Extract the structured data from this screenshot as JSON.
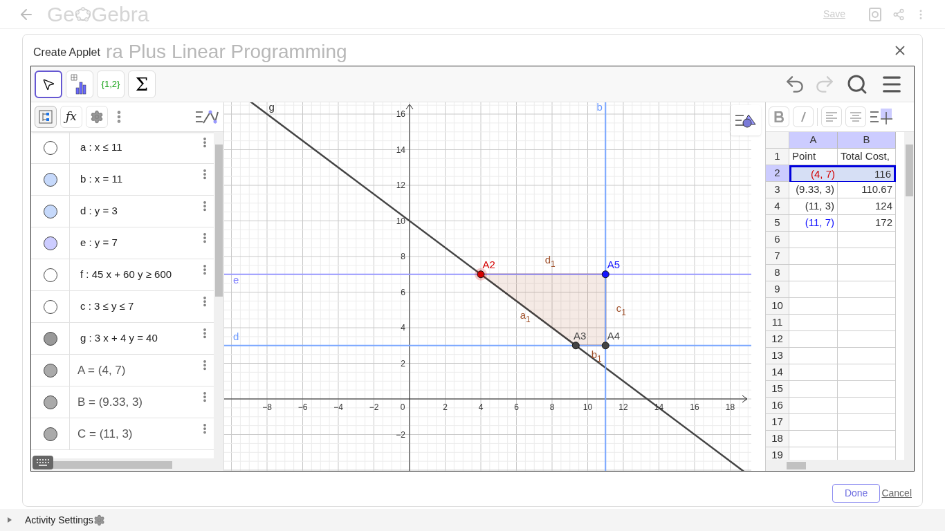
{
  "header": {
    "logo_left": "Ge",
    "logo_right": "Gebra",
    "save": "Save"
  },
  "background_title": "ra Plus Linear Programming",
  "dialog": {
    "title": "Create Applet",
    "done": "Done",
    "cancel": "Cancel"
  },
  "toolbar": {
    "tools": [
      {
        "kind": "move",
        "selected": true
      },
      {
        "kind": "chart",
        "selected": false
      },
      {
        "kind": "list",
        "label": "{1,2}",
        "selected": false
      },
      {
        "kind": "sum",
        "label": "Σ",
        "selected": false
      }
    ]
  },
  "algebra": {
    "tabs": [
      {
        "kind": "tree",
        "selected": true
      },
      {
        "kind": "fx",
        "label": "ƒx",
        "selected": false
      },
      {
        "kind": "gear",
        "selected": false
      }
    ],
    "items": [
      {
        "text": "a : x ≤ 11",
        "shown": false,
        "kind": "equation"
      },
      {
        "text": "b : x = 11",
        "shown": true,
        "color": "#c6d9fb",
        "kind": "equation"
      },
      {
        "text": "d : y = 3",
        "shown": true,
        "color": "#c6d9fb",
        "kind": "equation"
      },
      {
        "text": "e : y = 7",
        "shown": true,
        "color": "#ccccff",
        "kind": "equation"
      },
      {
        "text": "f : 45 x + 60 y ≥ 600",
        "shown": false,
        "kind": "equation"
      },
      {
        "text": "c : 3 ≤ y ≤ 7",
        "shown": false,
        "kind": "equation"
      },
      {
        "text": "g : 3 x + 4 y = 40",
        "shown": true,
        "color": "#999999",
        "kind": "equation"
      },
      {
        "text": "A = (4, 7)",
        "shown": true,
        "color": "#aaaaaa",
        "kind": "value"
      },
      {
        "text": "B = (9.33, 3)",
        "shown": true,
        "color": "#aaaaaa",
        "kind": "value"
      },
      {
        "text": "C = (11, 3)",
        "shown": true,
        "color": "#aaaaaa",
        "kind": "value"
      }
    ]
  },
  "graph": {
    "x_ticks": [
      "−8",
      "−6",
      "−4",
      "−2",
      "2",
      "4",
      "6",
      "8",
      "10",
      "12",
      "14",
      "16",
      "18"
    ],
    "origin": "0",
    "y_ticks": [
      "16",
      "14",
      "12",
      "10",
      "8",
      "6",
      "4",
      "2",
      "−2"
    ],
    "line_labels": [
      "g",
      "b",
      "e",
      "d"
    ],
    "segment_labels": [
      {
        "name": "d",
        "sub": "1"
      },
      {
        "name": "c",
        "sub": "1"
      },
      {
        "name": "a",
        "sub": "1"
      },
      {
        "name": "b",
        "sub": "1"
      }
    ],
    "points": [
      {
        "label": "A2",
        "color": "#d40000"
      },
      {
        "label": "A5",
        "color": "#1515ff"
      },
      {
        "label": "A3",
        "color": "#444444"
      },
      {
        "label": "A4",
        "color": "#444444"
      }
    ]
  },
  "spreadsheet": {
    "columns": [
      {
        "label": "A",
        "selected": true
      },
      {
        "label": "B",
        "selected": true
      }
    ],
    "rows": [
      {
        "number": "1",
        "selected": false,
        "cells": [
          {
            "text": "Point"
          },
          {
            "text": "Total Cost,"
          }
        ]
      },
      {
        "number": "2",
        "selected": true,
        "cells": [
          {
            "text": "(4, 7)",
            "color": "#d40000"
          },
          {
            "text": "116"
          }
        ]
      },
      {
        "number": "3",
        "selected": false,
        "cells": [
          {
            "text": "(9.33, 3)"
          },
          {
            "text": "110.67"
          }
        ]
      },
      {
        "number": "4",
        "selected": false,
        "cells": [
          {
            "text": "(11, 3)"
          },
          {
            "text": "124"
          }
        ]
      },
      {
        "number": "5",
        "selected": false,
        "cells": [
          {
            "text": "(11, 7)",
            "color": "#1515ff"
          },
          {
            "text": "172"
          }
        ]
      },
      {
        "number": "6",
        "selected": false,
        "cells": []
      },
      {
        "number": "7",
        "selected": false,
        "cells": []
      },
      {
        "number": "8",
        "selected": false,
        "cells": []
      },
      {
        "number": "9",
        "selected": false,
        "cells": []
      },
      {
        "number": "10",
        "selected": false,
        "cells": []
      },
      {
        "number": "11",
        "selected": false,
        "cells": []
      },
      {
        "number": "12",
        "selected": false,
        "cells": []
      },
      {
        "number": "13",
        "selected": false,
        "cells": []
      },
      {
        "number": "14",
        "selected": false,
        "cells": []
      },
      {
        "number": "15",
        "selected": false,
        "cells": []
      },
      {
        "number": "16",
        "selected": false,
        "cells": []
      },
      {
        "number": "17",
        "selected": false,
        "cells": []
      },
      {
        "number": "18",
        "selected": false,
        "cells": []
      },
      {
        "number": "19",
        "selected": false,
        "cells": []
      }
    ]
  },
  "footer": {
    "label": "Activity Settings",
    "expanded": false
  }
}
